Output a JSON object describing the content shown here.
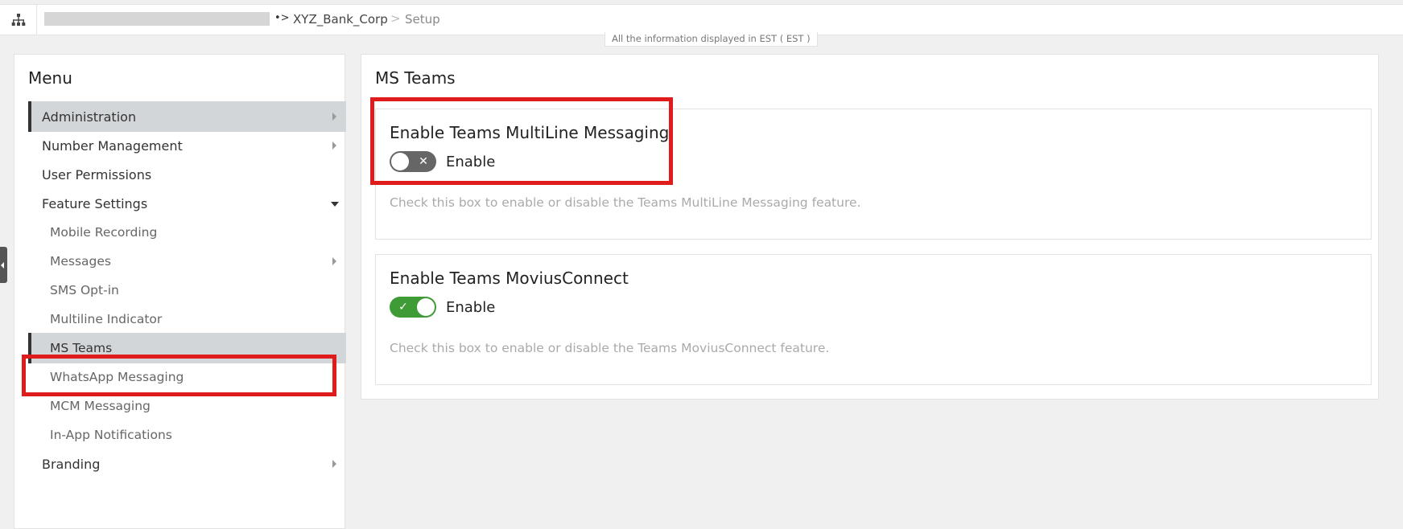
{
  "breadcrumb": {
    "org": "XYZ_Bank_Corp",
    "separator": ">",
    "current": "Setup"
  },
  "timezone_note": "All the information displayed in EST ( EST )",
  "sidebar": {
    "title": "Menu",
    "items": [
      {
        "label": "Administration",
        "level": 1,
        "active": true,
        "chevron": "right"
      },
      {
        "label": "Number Management",
        "level": 1,
        "active": false,
        "chevron": "right"
      },
      {
        "label": "User Permissions",
        "level": 1,
        "active": false,
        "chevron": ""
      },
      {
        "label": "Feature Settings",
        "level": 1,
        "active": false,
        "chevron": "down"
      },
      {
        "label": "Mobile Recording",
        "level": 2,
        "active": false,
        "chevron": ""
      },
      {
        "label": "Messages",
        "level": 2,
        "active": false,
        "chevron": "right"
      },
      {
        "label": "SMS Opt-in",
        "level": 2,
        "active": false,
        "chevron": ""
      },
      {
        "label": "Multiline Indicator",
        "level": 2,
        "active": false,
        "chevron": ""
      },
      {
        "label": "MS Teams",
        "level": 2,
        "active": true,
        "chevron": ""
      },
      {
        "label": "WhatsApp Messaging",
        "level": 2,
        "active": false,
        "chevron": ""
      },
      {
        "label": "MCM Messaging",
        "level": 2,
        "active": false,
        "chevron": ""
      },
      {
        "label": "In-App Notifications",
        "level": 2,
        "active": false,
        "chevron": ""
      },
      {
        "label": "Branding",
        "level": 1,
        "active": false,
        "chevron": "right"
      }
    ]
  },
  "main": {
    "title": "MS Teams",
    "settings": [
      {
        "title": "Enable Teams MultiLine Messaging",
        "toggle_label": "Enable",
        "enabled": false,
        "description": "Check this box to enable or disable the Teams MultiLine Messaging feature."
      },
      {
        "title": "Enable Teams MoviusConnect",
        "toggle_label": "Enable",
        "enabled": true,
        "description": "Check this box to enable or disable the Teams MoviusConnect feature."
      }
    ]
  },
  "colors": {
    "accent_highlight": "#e01b1b",
    "toggle_on": "#3e9b35",
    "toggle_off": "#666666",
    "active_item_bg": "#d3d6d9"
  }
}
